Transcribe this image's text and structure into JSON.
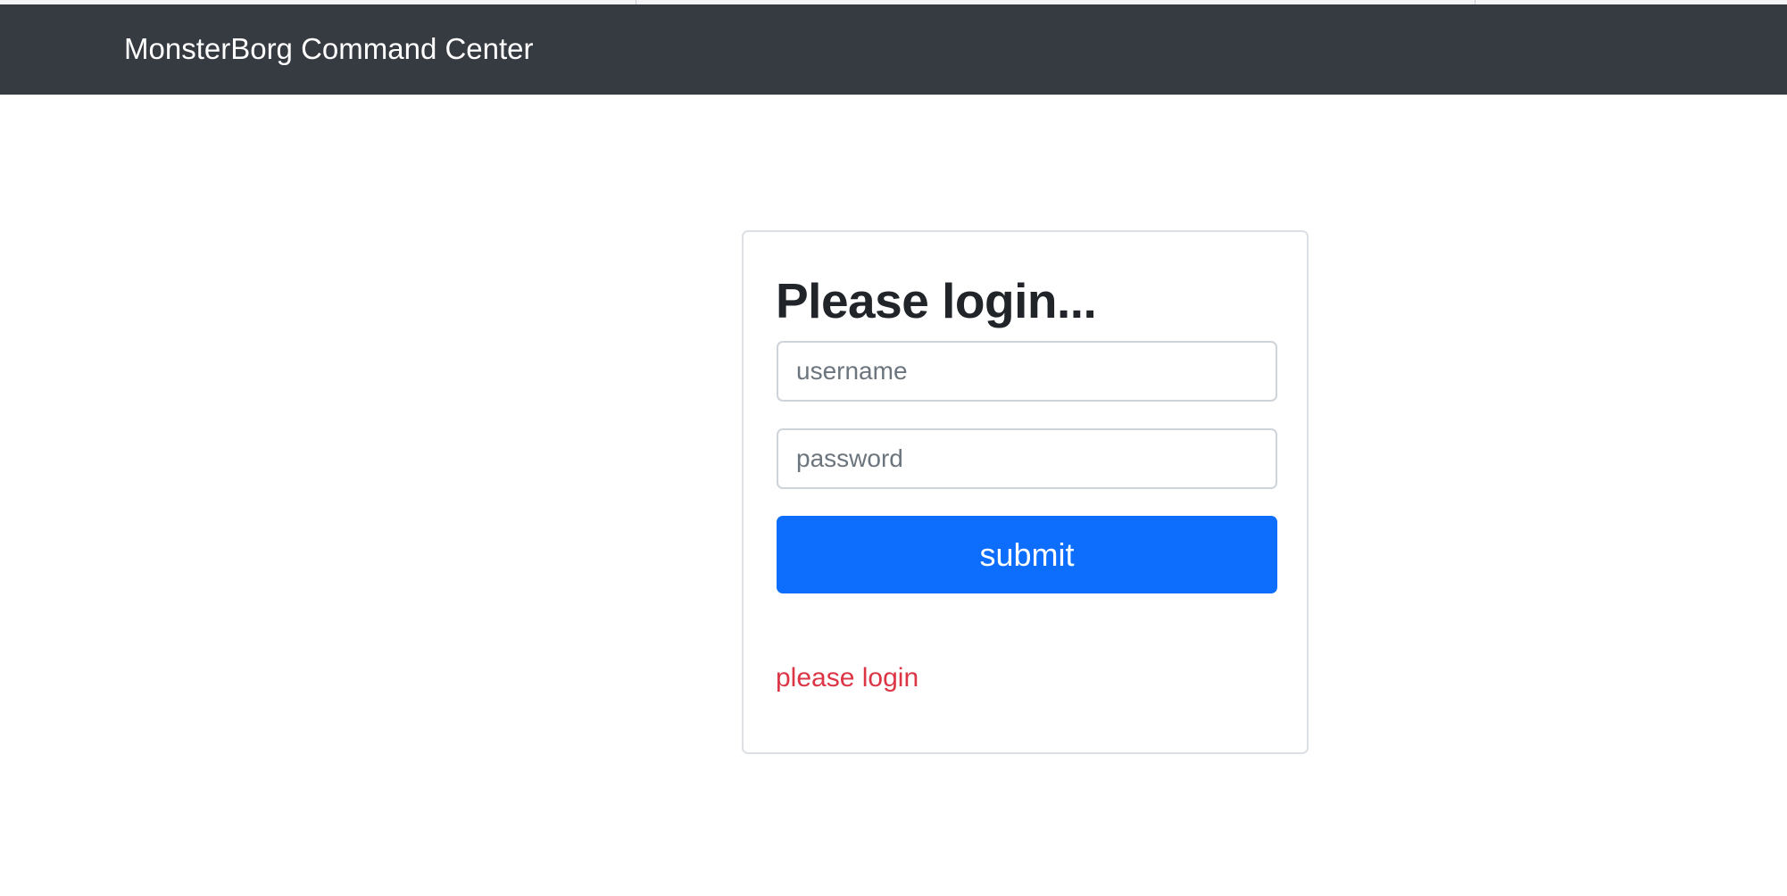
{
  "navbar": {
    "brand": "MonsterBorg Command Center"
  },
  "login": {
    "title": "Please login...",
    "username_placeholder": "username",
    "username_value": "",
    "password_placeholder": "password",
    "password_value": "",
    "submit_label": "submit",
    "status_message": "please login"
  },
  "colors": {
    "navbar_bg": "#363a41",
    "primary_button": "#0d6efd",
    "error_text": "#dc3545"
  }
}
